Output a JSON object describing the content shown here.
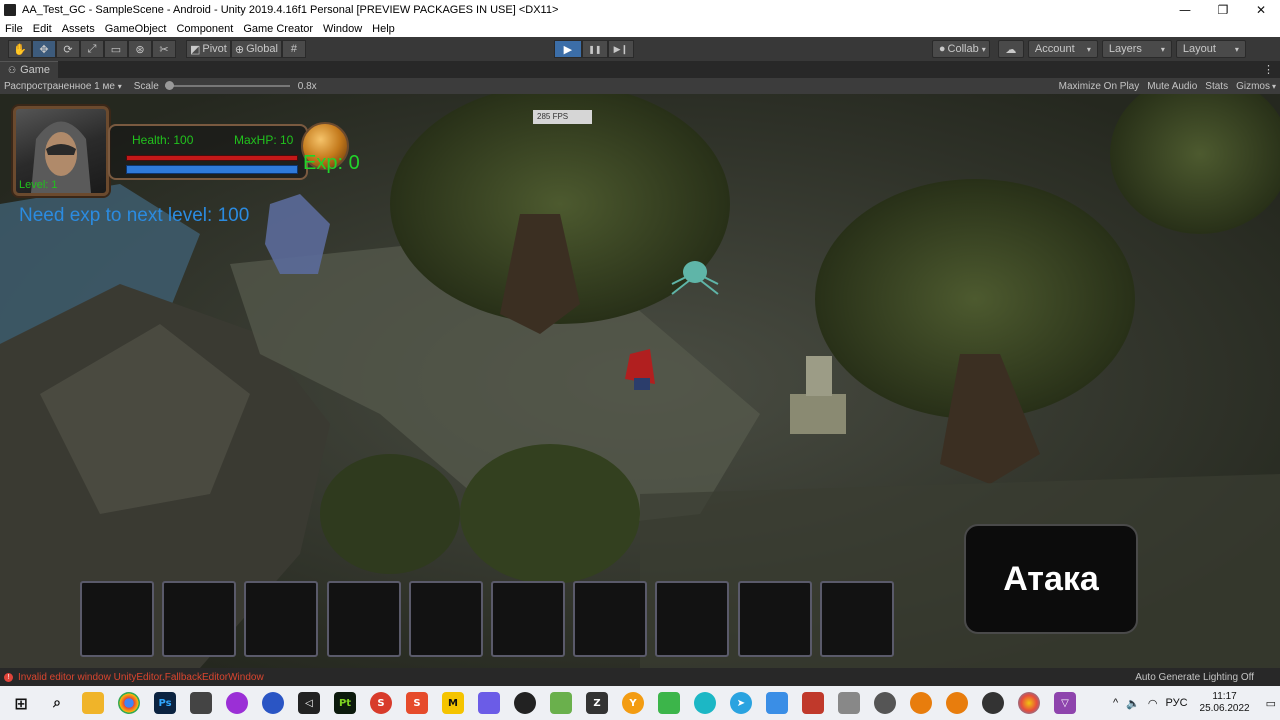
{
  "window": {
    "title": "AA_Test_GC - SampleScene - Android - Unity 2019.4.16f1 Personal [PREVIEW PACKAGES IN USE] <DX11>",
    "minimize": "—",
    "maximize": "❐",
    "close": "✕"
  },
  "menu": [
    "File",
    "Edit",
    "Assets",
    "GameObject",
    "Component",
    "Game Creator",
    "Window",
    "Help"
  ],
  "toolbar": {
    "pivot_label": "Pivot",
    "global_label": "Global",
    "play": "▶",
    "pause": "❚❚",
    "step": "▶❙",
    "collab_label": "Collab",
    "account_label": "Account",
    "layers_label": "Layers",
    "layout_label": "Layout"
  },
  "game_tab": {
    "label": "Game",
    "display_dropdown": "Распространенное 1 ме",
    "scale_label": "Scale",
    "scale_value": "0.8x",
    "scale_fraction": 0.0,
    "maximize_on_play": "Maximize On Play",
    "mute_audio": "Mute Audio",
    "stats": "Stats",
    "gizmos": "Gizmos"
  },
  "hud": {
    "health_label": "Health: 100",
    "maxhp_label": "MaxHP: 10",
    "exp_label": "Exp: 0",
    "level_label": "Level: 1",
    "need_exp_label": "Need exp to next level: 100",
    "fps_label": "285 FPS",
    "attack_label": "Атака",
    "health_fraction": 1.0,
    "exp_fraction": 1.0,
    "inventory_slots": 10
  },
  "status": {
    "error_text": "Invalid editor window UnityEditor.FallbackEditorWindow",
    "lighting_text": "Auto Generate Lighting Off"
  },
  "taskbar": {
    "lang": "РУС",
    "time": "11:17",
    "date": "25.06.2022"
  },
  "colors": {
    "hud_green": "#21c21d",
    "hud_blue": "#2b8be0",
    "editor_dark": "#383838",
    "error_red": "#d9452f"
  }
}
